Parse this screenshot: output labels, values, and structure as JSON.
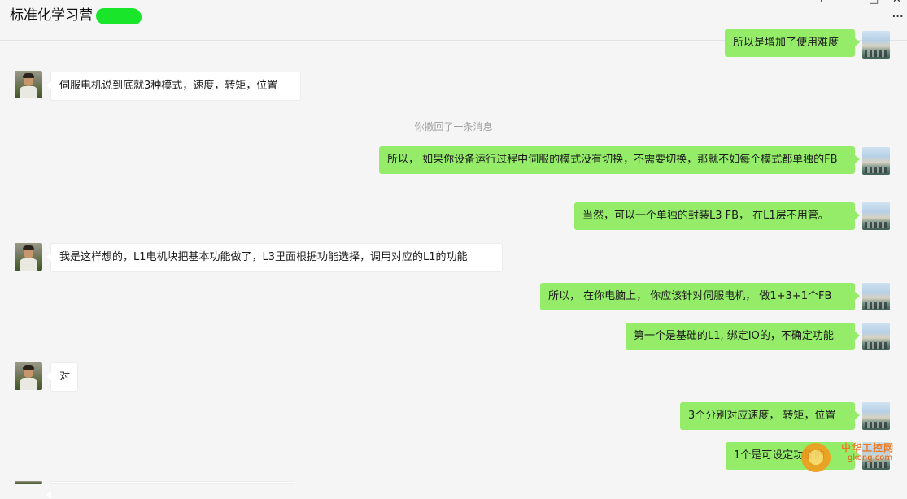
{
  "window": {
    "title": "标准化学习营",
    "controls": [
      "⊥",
      "—",
      "□",
      "✕"
    ],
    "more_label": "···"
  },
  "messages": [
    {
      "side": "right",
      "text": "所以是增加了使用难度"
    },
    {
      "side": "left",
      "text": "伺服电机说到底就3种模式，速度，转矩，位置"
    },
    {
      "side": "notice",
      "text": "你撤回了一条消息"
    },
    {
      "side": "right",
      "text": "所以，  如果你设备运行过程中伺服的模式没有切换，不需要切换，那就不如每个模式都单独的FB"
    },
    {
      "side": "right",
      "text": "当然，可以一个单独的封装L3 FB，  在L1层不用管。"
    },
    {
      "side": "left",
      "text": "我是这样想的，L1电机块把基本功能做了，L3里面根据功能选择，调用对应的L1的功能"
    },
    {
      "side": "right",
      "text": "所以，  在你电脑上，  你应该针对伺服电机，  做1+3+1个FB"
    },
    {
      "side": "right",
      "text": "第一个是基础的L1, 绑定IO的，不确定功能"
    },
    {
      "side": "left",
      "text": "对"
    },
    {
      "side": "right",
      "text": "3个分别对应速度，  转矩，位置"
    },
    {
      "side": "right",
      "text": "1个是可设定功能的"
    }
  ],
  "watermark": {
    "line1": "中华工控网",
    "line2": "gkong.com"
  },
  "colors": {
    "sent_bubble": "#95ec69",
    "received_bubble": "#ffffff",
    "background": "#f5f5f5"
  }
}
